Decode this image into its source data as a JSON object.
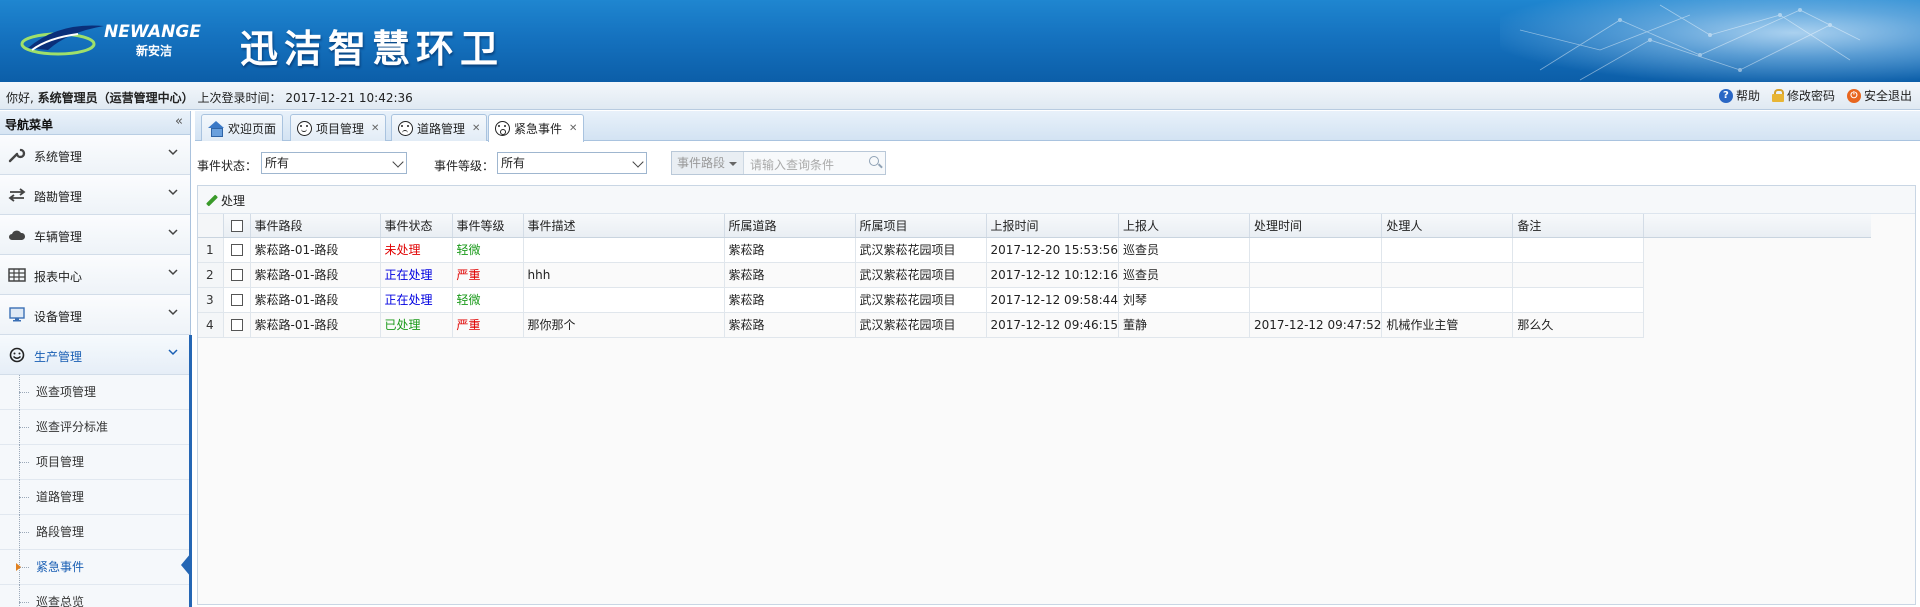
{
  "banner": {
    "logo_text": "NEWANGE",
    "logo_cn": "新安洁",
    "title": "迅洁智慧环卫"
  },
  "infobar": {
    "greeting_prefix": "你好,",
    "user": "系统管理员（运营管理中心）",
    "last_login_label": "上次登录时间：",
    "last_login_time": "2017-12-21 10:42:36",
    "actions": [
      {
        "label": "帮助",
        "icon": "help-icon"
      },
      {
        "label": "修改密码",
        "icon": "lock-icon"
      },
      {
        "label": "安全退出",
        "icon": "power-icon"
      }
    ]
  },
  "sidebar": {
    "title": "导航菜单",
    "collapse_glyph": "«",
    "groups": [
      {
        "label": "系统管理",
        "icon": "wrench-icon"
      },
      {
        "label": "踏勘管理",
        "icon": "arrows-icon"
      },
      {
        "label": "车辆管理",
        "icon": "cloud-icon"
      },
      {
        "label": "报表中心",
        "icon": "grid-icon"
      },
      {
        "label": "设备管理",
        "icon": "monitor-icon"
      },
      {
        "label": "生产管理",
        "icon": "smile-icon"
      }
    ],
    "subitems": [
      "巡查项管理",
      "巡查评分标准",
      "项目管理",
      "道路管理",
      "路段管理",
      "紧急事件",
      "巡查总览"
    ]
  },
  "tabs": [
    {
      "label": "欢迎页面",
      "icon": "home-icon",
      "closable": false
    },
    {
      "label": "项目管理",
      "icon": "smile-face-icon",
      "closable": true
    },
    {
      "label": "道路管理",
      "icon": "sad-face-icon",
      "closable": true
    },
    {
      "label": "紧急事件",
      "icon": "surprised-face-icon",
      "closable": true
    }
  ],
  "filters": {
    "status_label": "事件状态：",
    "status_value": "所有",
    "level_label": "事件等级：",
    "level_value": "所有",
    "search_scope": "事件路段",
    "search_placeholder": "请输入查询条件"
  },
  "toolbar": {
    "process_label": "处理"
  },
  "grid": {
    "columns": [
      "事件路段",
      "事件状态",
      "事件等级",
      "事件描述",
      "所属道路",
      "所属项目",
      "上报时间",
      "上报人",
      "处理时间",
      "处理人",
      "备注"
    ],
    "rows": [
      {
        "n": "1",
        "segment": "紫菘路-01-路段",
        "status": "未处理",
        "status_color": "#e00000",
        "level": "轻微",
        "level_color": "#1a9a1a",
        "desc": "",
        "road": "紫菘路",
        "project": "武汉紫菘花园项目",
        "report_time": "2017-12-20 15:53:56",
        "reporter": "巡查员",
        "handle_time": "",
        "handler": "",
        "note": ""
      },
      {
        "n": "2",
        "segment": "紫菘路-01-路段",
        "status": "正在处理",
        "status_color": "#0000e0",
        "level": "严重",
        "level_color": "#e00000",
        "desc": "hhh",
        "road": "紫菘路",
        "project": "武汉紫菘花园项目",
        "report_time": "2017-12-12 10:12:16",
        "reporter": "巡查员",
        "handle_time": "",
        "handler": "",
        "note": ""
      },
      {
        "n": "3",
        "segment": "紫菘路-01-路段",
        "status": "正在处理",
        "status_color": "#0000e0",
        "level": "轻微",
        "level_color": "#1a9a1a",
        "desc": "",
        "road": "紫菘路",
        "project": "武汉紫菘花园项目",
        "report_time": "2017-12-12 09:58:44",
        "reporter": "刘琴",
        "handle_time": "",
        "handler": "",
        "note": ""
      },
      {
        "n": "4",
        "segment": "紫菘路-01-路段",
        "status": "已处理",
        "status_color": "#1a9a1a",
        "level": "严重",
        "level_color": "#e00000",
        "desc": "那你那个",
        "road": "紫菘路",
        "project": "武汉紫菘花园项目",
        "report_time": "2017-12-12 09:46:15",
        "reporter": "董静",
        "handle_time": "2017-12-12 09:47:52",
        "handler": "机械作业主管",
        "note": "那么久"
      }
    ]
  }
}
